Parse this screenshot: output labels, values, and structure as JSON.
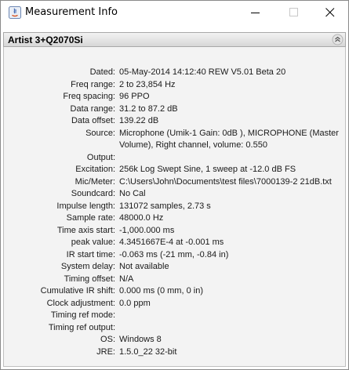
{
  "window": {
    "title": "Measurement Info"
  },
  "panel": {
    "title": "Artist 3+Q2070Si"
  },
  "icons": {
    "app": "java-app-icon",
    "minimize": "minimize-icon",
    "maximize": "maximize-icon",
    "close": "close-icon",
    "collapse": "double-chevron-up-icon"
  },
  "info": [
    {
      "label": "Dated:",
      "value": "05-May-2014 14:12:40 REW V5.01 Beta 20"
    },
    {
      "label": "Freq range:",
      "value": "2 to 23,854 Hz"
    },
    {
      "label": "Freq spacing:",
      "value": "96 PPO"
    },
    {
      "label": "Data range:",
      "value": "31.2 to 87.2 dB"
    },
    {
      "label": "Data offset:",
      "value": "139.22 dB"
    },
    {
      "label": "Source:",
      "value": "Microphone (Umik-1  Gain: 0dB  ), MICROPHONE (Master Volume), Right channel, volume: 0.550"
    },
    {
      "label": "Output:",
      "value": ""
    },
    {
      "label": "Excitation:",
      "value": "256k Log Swept Sine, 1 sweep at -12.0 dB FS"
    },
    {
      "label": "Mic/Meter:",
      "value": "C:\\Users\\John\\Documents\\test files\\7000139-2 21dB.txt"
    },
    {
      "label": "Soundcard:",
      "value": "No Cal"
    },
    {
      "label": "Impulse length:",
      "value": "131072 samples, 2.73 s"
    },
    {
      "label": "Sample rate:",
      "value": "48000.0 Hz"
    },
    {
      "label": "Time axis start:",
      "value": "-1,000.000 ms"
    },
    {
      "label": "peak value:",
      "value": "4.3451667E-4 at -0.001 ms"
    },
    {
      "label": "IR start time:",
      "value": "-0.063 ms (-21 mm, -0.84 in)"
    },
    {
      "label": "System delay:",
      "value": "Not available"
    },
    {
      "label": "Timing offset:",
      "value": "N/A"
    },
    {
      "label": "Cumulative IR shift:",
      "value": "0.000 ms (0 mm, 0 in)"
    },
    {
      "label": "Clock adjustment:",
      "value": "0.0 ppm"
    },
    {
      "label": "Timing ref mode:",
      "value": ""
    },
    {
      "label": "Timing ref output:",
      "value": ""
    },
    {
      "label": "OS:",
      "value": "Windows 8"
    },
    {
      "label": "JRE:",
      "value": "1.5.0_22 32-bit"
    }
  ]
}
